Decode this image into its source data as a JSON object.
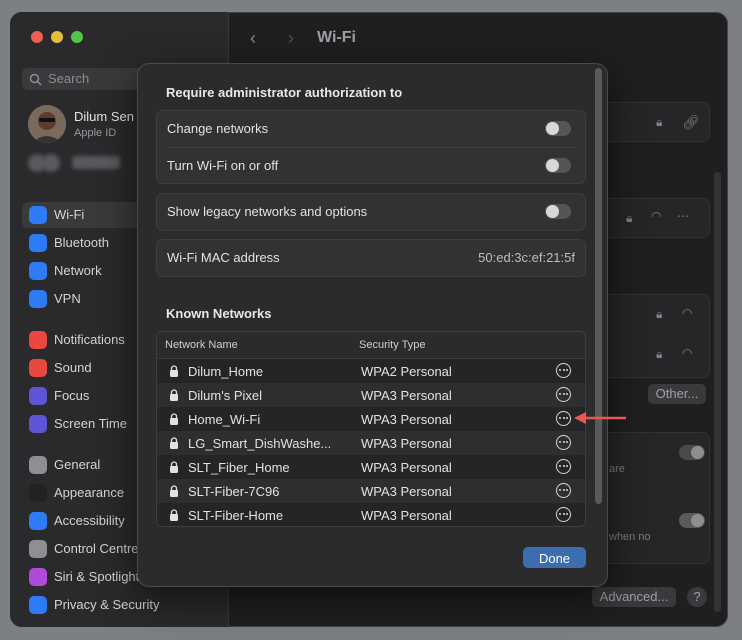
{
  "window": {
    "title": "Wi-Fi"
  },
  "sidebar": {
    "search_placeholder": "Search",
    "profile": {
      "name": "Dilum Sen",
      "subtitle": "Apple ID"
    },
    "items": [
      {
        "label": "Wi-Fi",
        "icon": "wifi-icon",
        "color": "#2d7cf6"
      },
      {
        "label": "Bluetooth",
        "icon": "bluetooth-icon",
        "color": "#2d7cf6"
      },
      {
        "label": "Network",
        "icon": "globe-icon",
        "color": "#2d7cf6"
      },
      {
        "label": "VPN",
        "icon": "globe-icon",
        "color": "#2d7cf6"
      },
      {
        "label": "Notifications",
        "icon": "bell-icon",
        "color": "#e8483d"
      },
      {
        "label": "Sound",
        "icon": "speaker-icon",
        "color": "#e8483d"
      },
      {
        "label": "Focus",
        "icon": "moon-icon",
        "color": "#5d55d6"
      },
      {
        "label": "Screen Time",
        "icon": "hourglass-icon",
        "color": "#5d55d6"
      },
      {
        "label": "General",
        "icon": "gear-icon",
        "color": "#8e8e93"
      },
      {
        "label": "Appearance",
        "icon": "appearance-icon",
        "color": "#222"
      },
      {
        "label": "Accessibility",
        "icon": "accessibility-icon",
        "color": "#2d7cf6"
      },
      {
        "label": "Control Centre",
        "icon": "control-centre-icon",
        "color": "#8e8e93"
      },
      {
        "label": "Siri & Spotlight",
        "icon": "siri-icon",
        "color": "#b04ad8"
      },
      {
        "label": "Privacy & Security",
        "icon": "hand-icon",
        "color": "#2d7cf6"
      }
    ]
  },
  "background": {
    "other_button": "Other...",
    "advanced_button": "Advanced...",
    "help_button": "?",
    "snippet_are": "are",
    "snippet_when_no": "when no"
  },
  "modal": {
    "admin_heading": "Require administrator authorization to",
    "change_networks": "Change networks",
    "turn_wifi": "Turn Wi-Fi on or off",
    "legacy": "Show legacy networks and options",
    "mac_label": "Wi-Fi MAC address",
    "mac_value": "50:ed:3c:ef:21:5f",
    "known_heading": "Known Networks",
    "columns": {
      "name": "Network Name",
      "security": "Security Type"
    },
    "networks": [
      {
        "name": "Dilum_Home",
        "security": "WPA2 Personal"
      },
      {
        "name": "Dilum's Pixel",
        "security": "WPA3 Personal"
      },
      {
        "name": "Home_Wi-Fi",
        "security": "WPA3 Personal"
      },
      {
        "name": "LG_Smart_DishWashe...",
        "security": "WPA3 Personal"
      },
      {
        "name": "SLT_Fiber_Home",
        "security": "WPA3 Personal"
      },
      {
        "name": "SLT-Fiber-7C96",
        "security": "WPA3 Personal"
      },
      {
        "name": "SLT-Fiber-Home",
        "security": "WPA3 Personal"
      }
    ],
    "done_label": "Done"
  },
  "colors": {
    "accent": "#3c6db0",
    "annotation_arrow": "#e8584f"
  }
}
